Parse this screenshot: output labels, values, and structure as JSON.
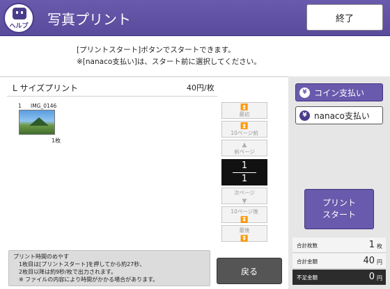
{
  "header": {
    "help_label": "ヘルプ",
    "title": "写真プリント",
    "end_label": "終了"
  },
  "message": {
    "line1": "[プリントスタート]ボタンでスタートできます。",
    "line2": "※[nanaco支払い]は、スタート前に選択してください。"
  },
  "print_size": {
    "label": "L サイズプリント",
    "price": "40円/枚"
  },
  "images": [
    {
      "index": "1",
      "name": "IMG_0146",
      "count": "1枚"
    }
  ],
  "pager": {
    "first": "最初",
    "back10": "10ページ前",
    "prev": "前ページ",
    "current": "1",
    "total": "1",
    "next": "次ページ",
    "next10": "10ページ後",
    "last": "最後"
  },
  "payment": {
    "coin": "コイン支払い",
    "nanaco": "nanaco支払い",
    "yen_icon": "¥"
  },
  "print_start": {
    "line1": "プリント",
    "line2": "スタート"
  },
  "summary": {
    "total_count_label": "合計枚数",
    "total_count": "1",
    "count_unit": "枚",
    "total_amount_label": "合計金額",
    "total_amount": "40",
    "amount_unit": "円",
    "shortage_label": "不足金額",
    "shortage": "0",
    "shortage_unit": "円"
  },
  "notice": {
    "title": "プリント時間のめやす",
    "line1": "1枚目は[プリントスタート]を押してから約27秒、",
    "line2": "2枚目以降は約9秒/枚で出力されます。",
    "line3": "※ ファイルの内容により時間がかかる場合があります。"
  },
  "back_label": "戻る",
  "colors": {
    "accent": "#6a5aad",
    "accent_dark": "#3f3380"
  }
}
